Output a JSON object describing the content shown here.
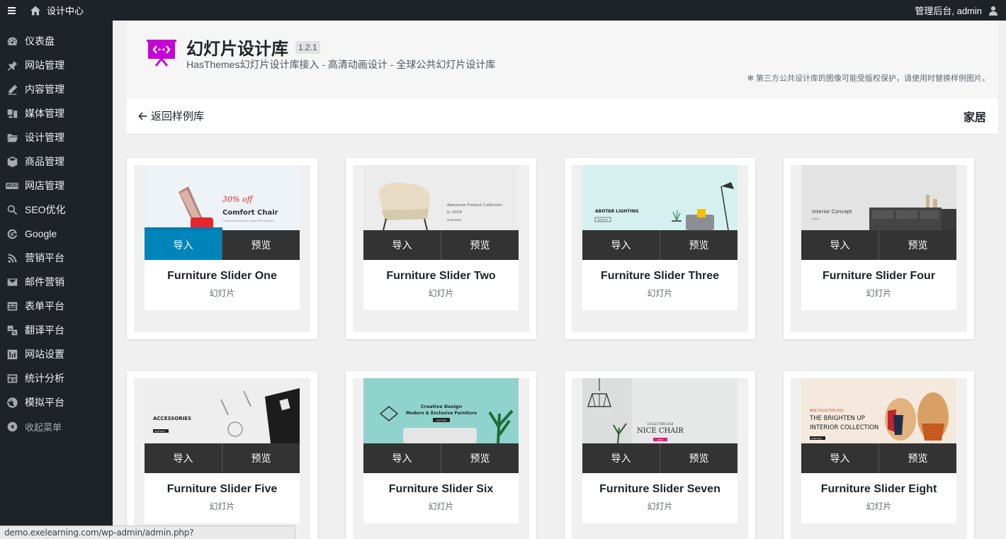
{
  "adminbar": {
    "site_name": "设计中心",
    "account_text": "管理后台, admin"
  },
  "sidebar": {
    "items": [
      {
        "label": "仪表盘",
        "icon": "dashboard-icon"
      },
      {
        "label": "网站管理",
        "icon": "pin-icon"
      },
      {
        "label": "内容管理",
        "icon": "pencil-icon"
      },
      {
        "label": "媒体管理",
        "icon": "media-icon"
      },
      {
        "label": "设计管理",
        "icon": "folder-icon"
      },
      {
        "label": "商品管理",
        "icon": "box-icon"
      },
      {
        "label": "网店管理",
        "icon": "woo-icon",
        "badge": "WOO"
      },
      {
        "label": "SEO优化",
        "icon": "search-icon"
      },
      {
        "label": "Google",
        "icon": "google-icon"
      },
      {
        "label": "营销平台",
        "icon": "rss-icon"
      },
      {
        "label": "邮件营销",
        "icon": "mail-icon"
      },
      {
        "label": "表单平台",
        "icon": "form-icon"
      },
      {
        "label": "翻译平台",
        "icon": "translate-icon"
      },
      {
        "label": "网站设置",
        "icon": "settings-icon"
      },
      {
        "label": "统计分析",
        "icon": "analytics-icon"
      },
      {
        "label": "模拟平台",
        "icon": "globe-icon"
      }
    ],
    "collapse_label": "收起菜单"
  },
  "header": {
    "title": "幻灯片设计库",
    "version": "1.2.1",
    "subtitle": "HasThemes幻灯片设计库接入 - 高清动画设计 - 全球公共幻灯片设计库",
    "notice": "✻ 第三方公共设计库的图像可能受版权保护，请使用时替换样例图片。"
  },
  "nav": {
    "back_label": "返回样例库",
    "category": "家居"
  },
  "cards": [
    {
      "name": "Furniture Slider One",
      "type": "幻灯片",
      "import": "导入",
      "preview": "预览",
      "thumb_text": [
        "30% off",
        "Comfort Chair",
        "Collect from Devonic & get 30% Discount"
      ]
    },
    {
      "name": "Furniture Slider Two",
      "type": "幻灯片",
      "import": "导入",
      "preview": "预览",
      "thumb_text": [
        "Awesome Product Collection",
        "In 2019",
        "SHOP NOW"
      ]
    },
    {
      "name": "Furniture Slider Three",
      "type": "幻灯片",
      "import": "导入",
      "preview": "预览",
      "thumb_text": [
        "ABOTAR LIGHTING",
        "SHOP NOW"
      ]
    },
    {
      "name": "Furniture Slider Four",
      "type": "幻灯片",
      "import": "导入",
      "preview": "预览",
      "thumb_text": [
        "Interior Concept",
        "Home"
      ]
    },
    {
      "name": "Furniture Slider Five",
      "type": "幻灯片",
      "import": "导入",
      "preview": "预览",
      "thumb_text": [
        "ACCESSORIES",
        "SHOP NOW"
      ]
    },
    {
      "name": "Furniture Slider Six",
      "type": "幻灯片",
      "import": "导入",
      "preview": "预览",
      "thumb_text": [
        "Creative Design",
        "Modern & Exclusive Furniture",
        "SHOP NOW"
      ]
    },
    {
      "name": "Furniture Slider Seven",
      "type": "幻灯片",
      "import": "导入",
      "preview": "预览",
      "thumb_text": [
        "COLLECTION 2018",
        "NICE CHAIR",
        "SHOP"
      ]
    },
    {
      "name": "Furniture Slider Eight",
      "type": "幻灯片",
      "import": "导入",
      "preview": "预览",
      "thumb_text": [
        "NEW COLLECTION 2020",
        "THE BRIGHTEN UP",
        "INTERIOR COLLECTION",
        "SHOP NOW"
      ]
    }
  ],
  "statusbar": {
    "url": "demo.exelearning.com/wp-admin/admin.php?page=htslider_templates#"
  },
  "colors": {
    "adminbar": "#1d2327",
    "primary_button": "#0085ba",
    "dark_button": "#333333",
    "logo": "#c800d6"
  }
}
